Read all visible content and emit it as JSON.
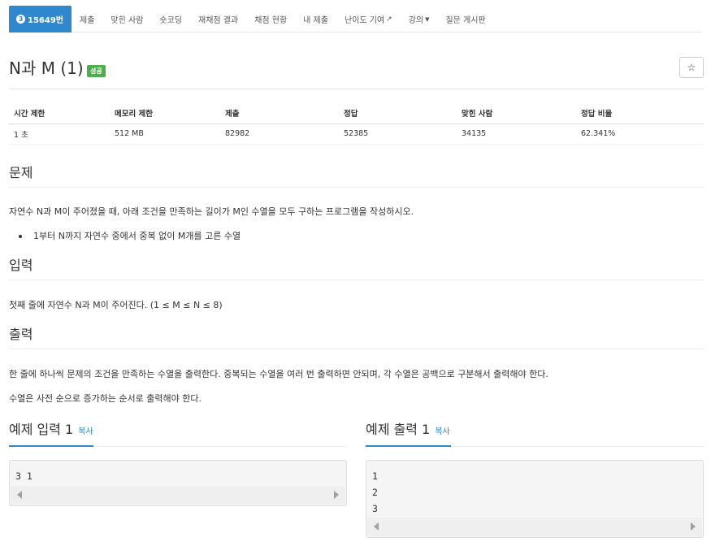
{
  "nav": {
    "problem_num_badge": "3",
    "problem_num": "15649번",
    "tabs": [
      "제출",
      "맞힌 사람",
      "숏코딩",
      "재채점 결과",
      "채점 현황",
      "내 제출",
      "난이도 기여",
      "강의",
      "질문 게시판"
    ]
  },
  "problem": {
    "title": "N과 M (1)",
    "status": "성공",
    "star": "☆"
  },
  "info_table": {
    "headers": [
      "시간 제한",
      "메모리 제한",
      "제출",
      "정답",
      "맞힌 사람",
      "정답 비율"
    ],
    "values": [
      "1 초",
      "512 MB",
      "82982",
      "52385",
      "34135",
      "62.341%"
    ]
  },
  "sections": {
    "problem_title": "문제",
    "problem_text": "자연수 N과 M이 주어졌을 때, 아래 조건을 만족하는 길이가 M인 수열을 모두 구하는 프로그램을 작성하시오.",
    "problem_bullet": "1부터 N까지 자연수 중에서 중복 없이 M개를 고른 수열",
    "input_title": "입력",
    "input_text": "첫째 줄에 자연수 N과 M이 주어진다. (1 ≤ M ≤ N ≤ 8)",
    "output_title": "출력",
    "output_text1": "한 줄에 하나씩 문제의 조건을 만족하는 수열을 출력한다. 중복되는 수열을 여러 번 출력하면 안되며, 각 수열은 공백으로 구분해서 출력해야 한다.",
    "output_text2": "수열은 사전 순으로 증가하는 순서로 출력해야 한다."
  },
  "examples": {
    "input_title": "예제 입력 1",
    "output_title": "예제 출력 1",
    "copy_label": "복사",
    "input_content": "3 1",
    "output_content": "1\n2\n3"
  },
  "colors": {
    "accent": "#2f87cc",
    "success": "#4cae4c"
  }
}
